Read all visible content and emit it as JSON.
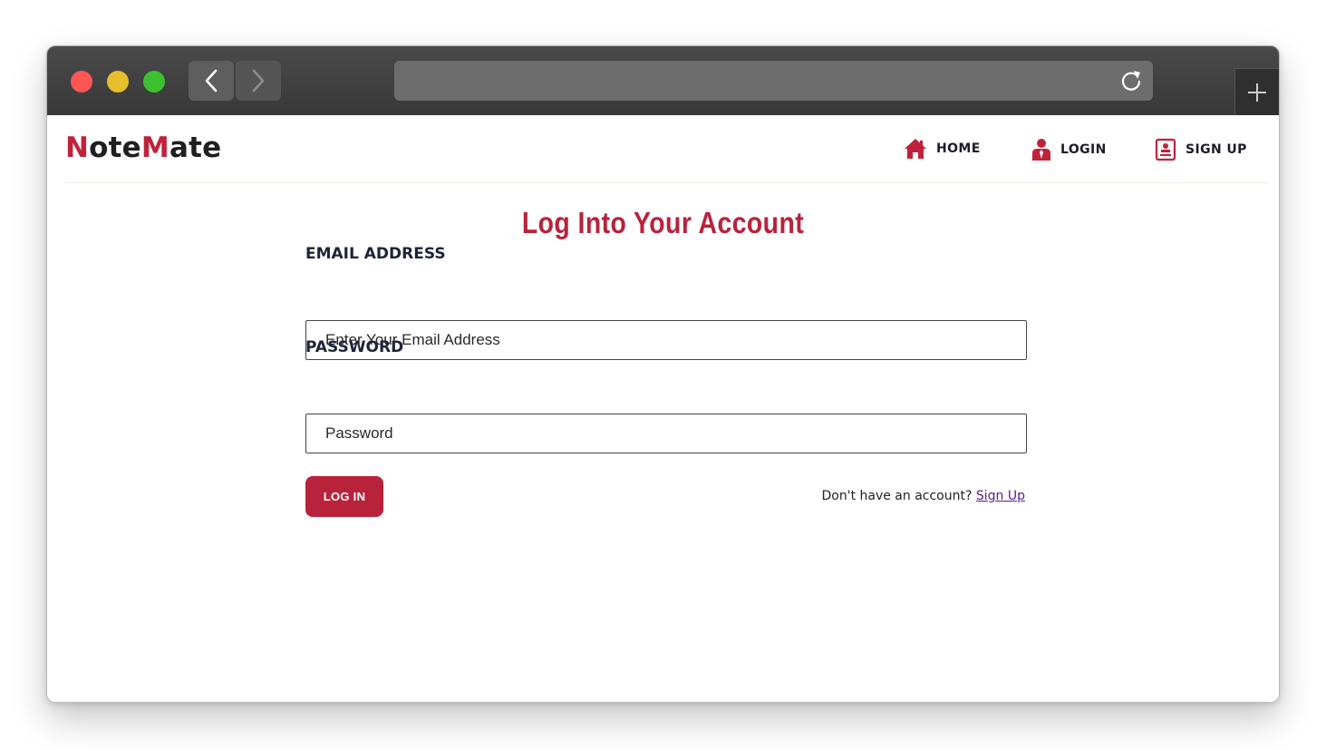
{
  "browser": {
    "url": "",
    "icons": {
      "back": "chevron-left-icon",
      "forward": "chevron-right-icon",
      "reload": "reload-icon",
      "new_tab": "plus-icon"
    }
  },
  "brand": {
    "part1_accent": "N",
    "part1_rest": "ote",
    "part2_accent": "M",
    "part2_rest": "ate",
    "accent_color": "#c0223b"
  },
  "nav": {
    "items": [
      {
        "label": "HOME",
        "icon": "home-icon"
      },
      {
        "label": "LOGIN",
        "icon": "user-icon"
      },
      {
        "label": "SIGN UP",
        "icon": "signup-form-icon"
      }
    ]
  },
  "form": {
    "title": "Log Into Your Account",
    "email_label": "EMAIL ADDRESS",
    "email_placeholder": "Enter Your Email Address",
    "email_value": "",
    "password_label": "PASSWORD",
    "password_placeholder": "Password",
    "password_value": "",
    "submit_label": "LOG IN",
    "signup_prompt": "Don't have an account?",
    "signup_link": "Sign Up"
  },
  "colors": {
    "primary": "#b9223b",
    "link": "#5b1a8e",
    "titlebar": "#3c3c3c"
  }
}
